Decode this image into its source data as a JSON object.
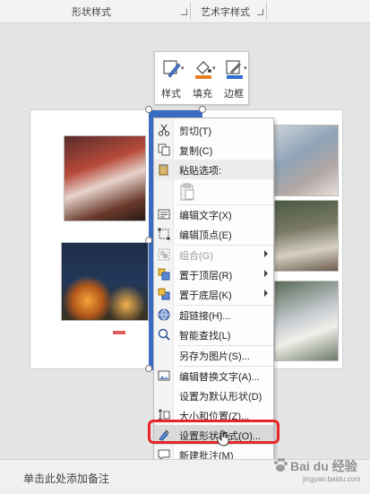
{
  "ribbon": {
    "groups": [
      {
        "label": "形状样式"
      },
      {
        "label": "艺术字样式"
      }
    ]
  },
  "mini_toolbar": {
    "buttons": [
      {
        "label": "样式",
        "icon": "pen-style-icon"
      },
      {
        "label": "填充",
        "icon": "paint-bucket-icon"
      },
      {
        "label": "边框",
        "icon": "outline-pen-icon"
      }
    ]
  },
  "context_menu": {
    "items": [
      {
        "label": "剪切(T)",
        "icon": "scissors-icon"
      },
      {
        "label": "复制(C)",
        "icon": "copy-icon"
      },
      {
        "label": "粘贴选项:",
        "icon": "paste-icon"
      },
      {
        "label": "编辑文字(X)",
        "icon": "edit-text-icon"
      },
      {
        "label": "编辑顶点(E)",
        "icon": "edit-points-icon"
      },
      {
        "label": "组合(G)",
        "icon": "group-icon"
      },
      {
        "label": "置于顶层(R)",
        "icon": "bring-front-icon"
      },
      {
        "label": "置于底层(K)",
        "icon": "send-back-icon"
      },
      {
        "label": "超链接(H)...",
        "icon": "hyperlink-icon"
      },
      {
        "label": "智能查找(L)",
        "icon": "smart-lookup-icon"
      },
      {
        "label": "另存为图片(S)...",
        "icon": ""
      },
      {
        "label": "编辑替换文字(A)...",
        "icon": "alt-text-icon"
      },
      {
        "label": "设置为默认形状(D)",
        "icon": ""
      },
      {
        "label": "大小和位置(Z)...",
        "icon": "size-position-icon"
      },
      {
        "label": "设置形状格式(O)...",
        "icon": "format-shape-icon"
      },
      {
        "label": "新建批注(M)",
        "icon": "new-comment-icon"
      }
    ]
  },
  "notes": {
    "placeholder": "单击此处添加备注"
  },
  "watermark": {
    "text": "Bai du 经验",
    "sub": "jingyan.baidu.com"
  },
  "colors": {
    "shape_fill": "#3b6cc4",
    "highlight": "#e8262a",
    "fill_icon": "#e67e22",
    "border_icon": "#2e6fd0"
  }
}
